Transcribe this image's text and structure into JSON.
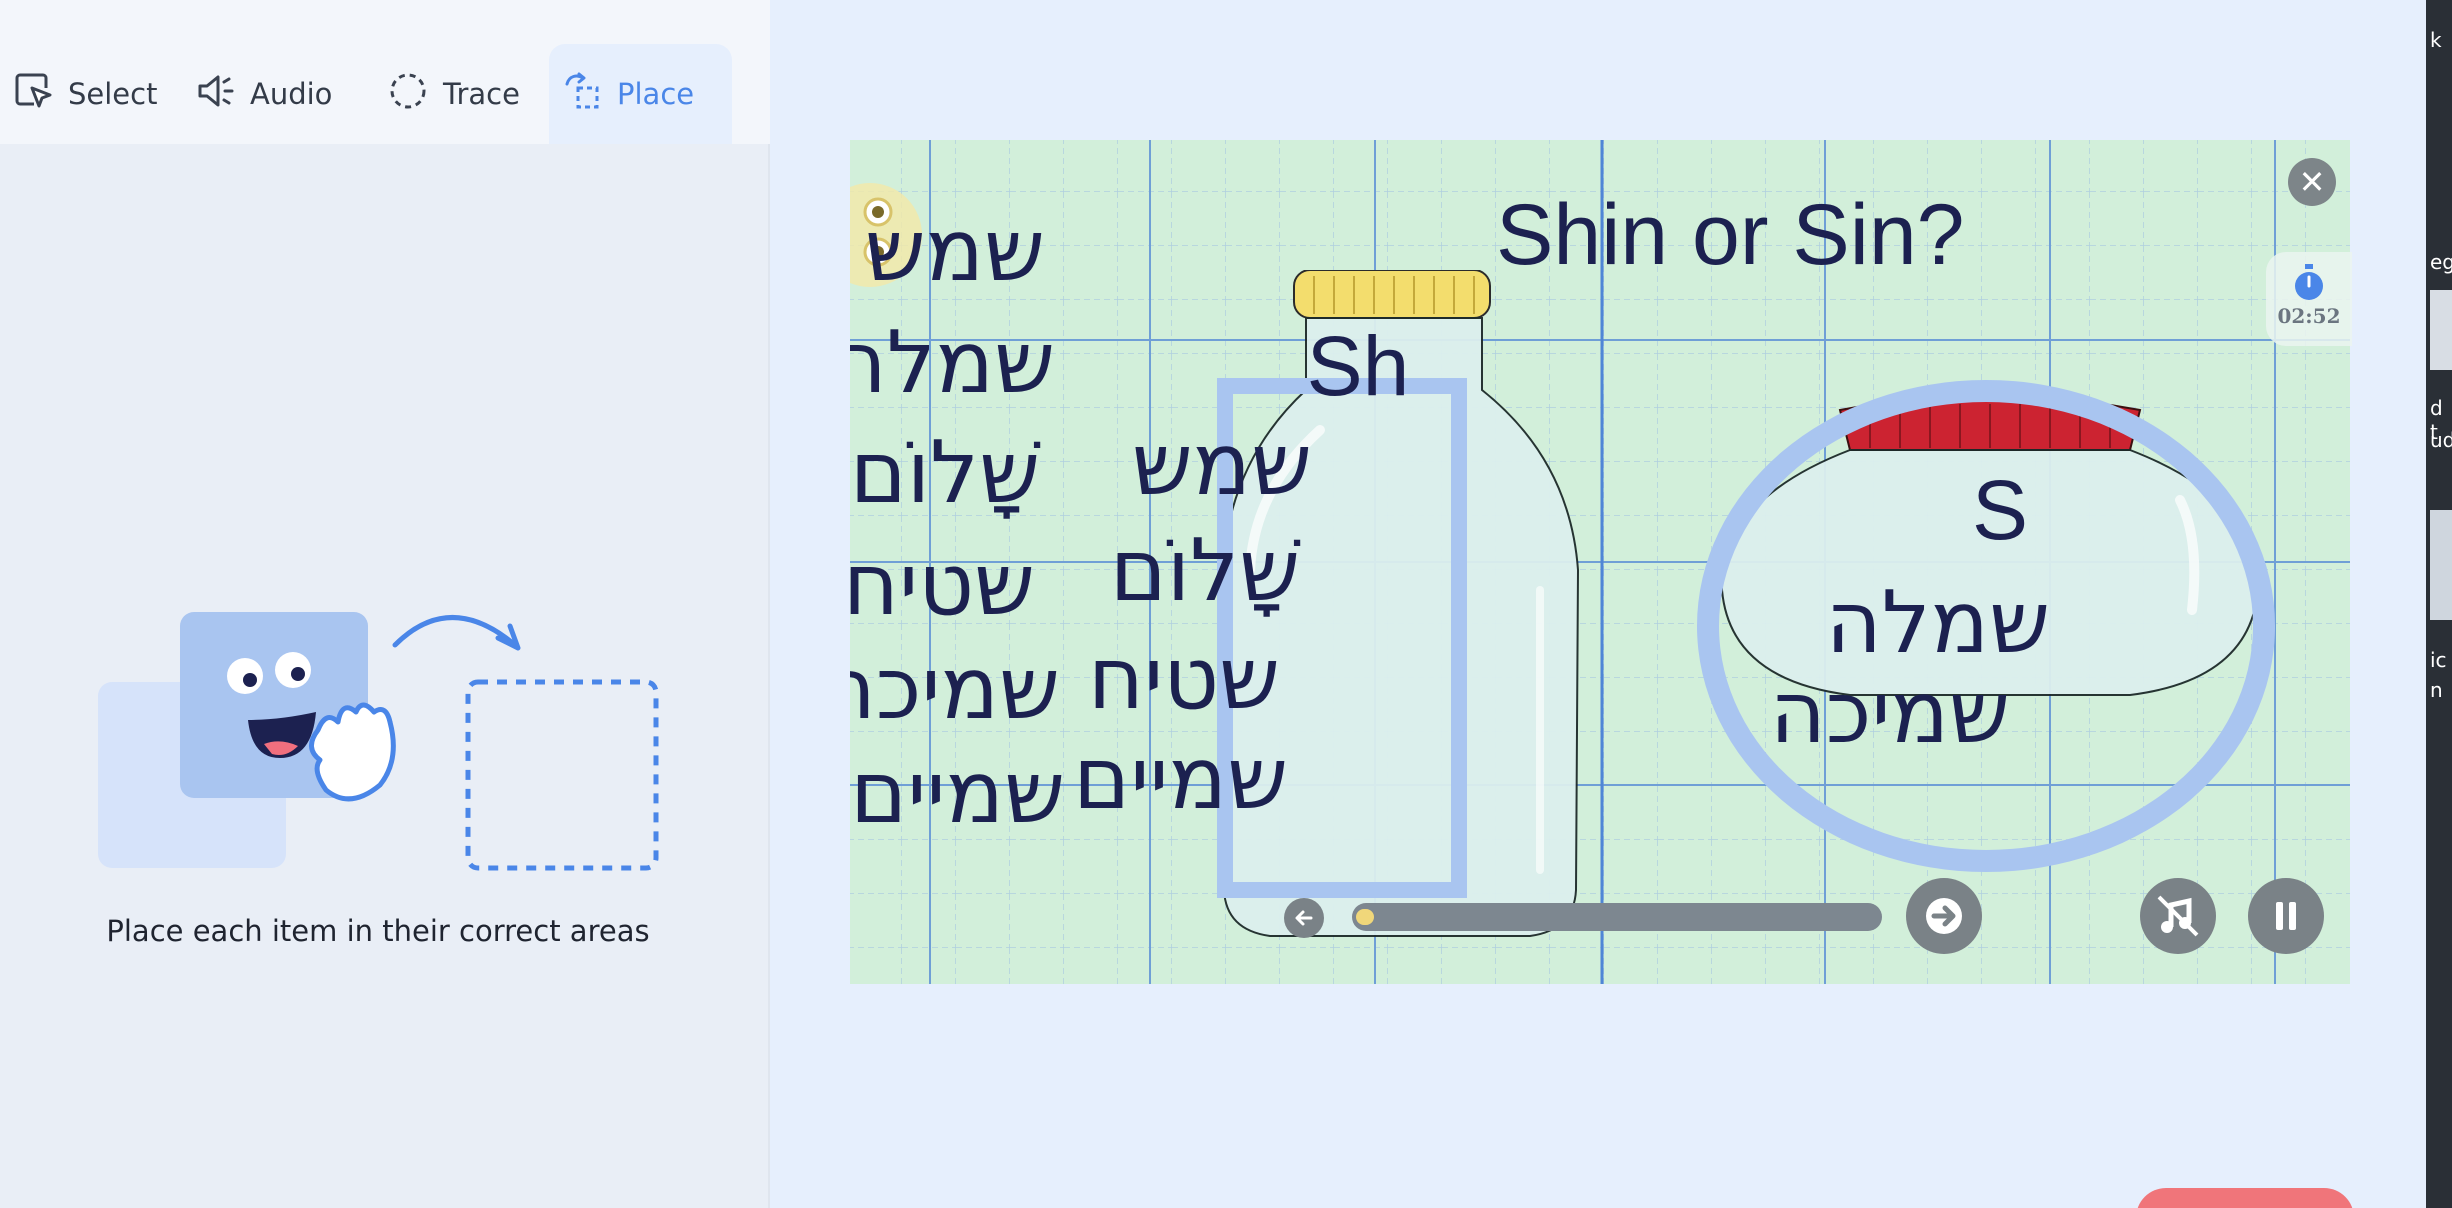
{
  "toolbar": {
    "tools": [
      {
        "label": "Select",
        "icon": "cursor-select-icon"
      },
      {
        "label": "Audio",
        "icon": "speaker-icon"
      },
      {
        "label": "Trace",
        "icon": "dashed-circle-icon"
      },
      {
        "label": "Place",
        "icon": "place-icon"
      }
    ],
    "active": "Place"
  },
  "left_panel": {
    "instruction": "Place each item in their correct areas"
  },
  "slide": {
    "title": "Shin or Sin?",
    "word_bank": [
      "שמש",
      "שמלה",
      "שָׁלוֹם",
      "שטיח",
      "שמיכה",
      "שמיים"
    ],
    "bottle_label": "Sh",
    "bottle_words": [
      "שמש",
      "שָׁלוֹם",
      "שטיח",
      "שמיים"
    ],
    "jar_label": "S",
    "jar_words": [
      "שמלה",
      "שמיכה"
    ],
    "timer": "02:52",
    "progress": 0.03
  },
  "colors": {
    "accent": "#4a86e8",
    "drop_zone": "#a9c5f0",
    "slide_bg": "#d2efda",
    "text_dark": "#1c2150"
  },
  "edge_texts": [
    "k",
    "eg",
    "d t",
    "ud",
    "ic",
    "n"
  ]
}
